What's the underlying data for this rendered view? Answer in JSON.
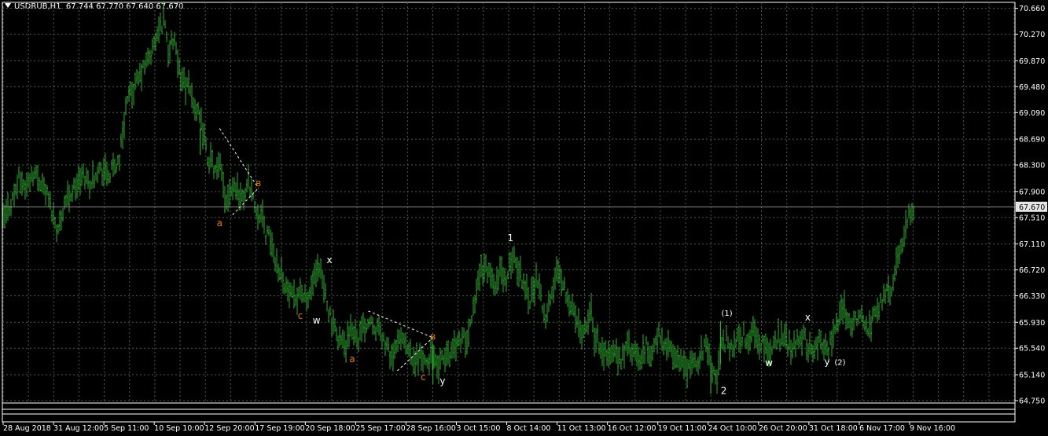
{
  "header": {
    "symbol_info": "USDRUB,H1",
    "ohlc": "67.744 67.770 67.640 67.670"
  },
  "colors": {
    "background": "#000000",
    "grid": "#4b5b4b",
    "bars": "#2faa2f",
    "price_line": "#8c8c8c",
    "price_label_bg": "#e6e6e6",
    "axis_text": "#ffffff",
    "wave_white": "#ffffff",
    "wave_orange": "#e07a10"
  },
  "chart_data": {
    "type": "ohlc-bar",
    "current_price": 67.67,
    "current_price_label": "67.670",
    "ylim": [
      64.75,
      70.75
    ],
    "y_ticks": [
      "70.660",
      "70.270",
      "69.870",
      "69.480",
      "69.090",
      "68.690",
      "68.300",
      "67.900",
      "67.510",
      "67.110",
      "66.720",
      "66.330",
      "65.930",
      "65.540",
      "65.140",
      "64.750"
    ],
    "x_ticks": [
      "28 Aug 2018",
      "31 Aug 12:00",
      "5 Sep 11:00",
      "10 Sep 10:00",
      "12 Sep 20:00",
      "17 Sep 19:00",
      "20 Sep 18:00",
      "25 Sep 17:00",
      "28 Sep 16:00",
      "3 Oct 15:00",
      "8 Oct 14:00",
      "11 Oct 13:00",
      "16 Oct 12:00",
      "19 Oct 11:00",
      "24 Oct 10:00",
      "26 Oct 20:00",
      "31 Oct 18:00",
      "6 Nov 17:00",
      "9 Nov 16:00"
    ],
    "price_path": [
      {
        "t": 0,
        "p": 67.45
      },
      {
        "t": 3,
        "p": 67.8
      },
      {
        "t": 5,
        "p": 68.1
      },
      {
        "t": 7,
        "p": 67.95
      },
      {
        "t": 9,
        "p": 68.2
      },
      {
        "t": 12,
        "p": 68.05
      },
      {
        "t": 14,
        "p": 67.8
      },
      {
        "t": 17,
        "p": 67.3
      },
      {
        "t": 19,
        "p": 67.75
      },
      {
        "t": 22,
        "p": 67.95
      },
      {
        "t": 25,
        "p": 68.15
      },
      {
        "t": 27,
        "p": 68.0
      },
      {
        "t": 29,
        "p": 68.25
      },
      {
        "t": 33,
        "p": 68.15
      },
      {
        "t": 36,
        "p": 68.4
      },
      {
        "t": 38,
        "p": 69.2
      },
      {
        "t": 41,
        "p": 69.5
      },
      {
        "t": 43,
        "p": 69.7
      },
      {
        "t": 46,
        "p": 70.0
      },
      {
        "t": 48,
        "p": 70.3
      },
      {
        "t": 50,
        "p": 70.55
      },
      {
        "t": 51,
        "p": 70.0
      },
      {
        "t": 53,
        "p": 70.2
      },
      {
        "t": 54,
        "p": 69.75
      },
      {
        "t": 56,
        "p": 69.55
      },
      {
        "t": 58,
        "p": 69.4
      },
      {
        "t": 60,
        "p": 69.1
      },
      {
        "t": 62,
        "p": 68.8
      },
      {
        "t": 63,
        "p": 68.45
      },
      {
        "t": 65,
        "p": 68.3
      },
      {
        "t": 66,
        "p": 68.15
      },
      {
        "t": 67,
        "p": 68.3
      },
      {
        "t": 69,
        "p": 67.75
      },
      {
        "t": 70,
        "p": 67.95
      },
      {
        "t": 72,
        "p": 68.0
      },
      {
        "t": 74,
        "p": 67.75
      },
      {
        "t": 76,
        "p": 68.05
      },
      {
        "t": 77,
        "p": 67.9
      },
      {
        "t": 78,
        "p": 67.65
      },
      {
        "t": 80,
        "p": 67.55
      },
      {
        "t": 81,
        "p": 67.3
      },
      {
        "t": 83,
        "p": 67.15
      },
      {
        "t": 84,
        "p": 66.9
      },
      {
        "t": 86,
        "p": 66.7
      },
      {
        "t": 88,
        "p": 66.4
      },
      {
        "t": 90,
        "p": 66.25
      },
      {
        "t": 92,
        "p": 66.45
      },
      {
        "t": 94,
        "p": 66.2
      },
      {
        "t": 96,
        "p": 66.55
      },
      {
        "t": 98,
        "p": 66.7
      },
      {
        "t": 99,
        "p": 66.5
      },
      {
        "t": 100,
        "p": 66.3
      },
      {
        "t": 102,
        "p": 65.85
      },
      {
        "t": 104,
        "p": 65.7
      },
      {
        "t": 106,
        "p": 65.55
      },
      {
        "t": 108,
        "p": 65.85
      },
      {
        "t": 110,
        "p": 65.7
      },
      {
        "t": 112,
        "p": 65.9
      },
      {
        "t": 114,
        "p": 66.0
      },
      {
        "t": 116,
        "p": 65.8
      },
      {
        "t": 118,
        "p": 65.65
      },
      {
        "t": 119,
        "p": 65.5
      },
      {
        "t": 121,
        "p": 65.4
      },
      {
        "t": 123,
        "p": 65.75
      },
      {
        "t": 125,
        "p": 65.5
      },
      {
        "t": 127,
        "p": 65.3
      },
      {
        "t": 129,
        "p": 65.45
      },
      {
        "t": 131,
        "p": 65.25
      },
      {
        "t": 133,
        "p": 65.55
      },
      {
        "t": 134,
        "p": 65.2
      },
      {
        "t": 136,
        "p": 65.35
      },
      {
        "t": 138,
        "p": 65.45
      },
      {
        "t": 140,
        "p": 65.6
      },
      {
        "t": 142,
        "p": 65.7
      },
      {
        "t": 144,
        "p": 65.65
      },
      {
        "t": 145,
        "p": 66.0
      },
      {
        "t": 146,
        "p": 66.3
      },
      {
        "t": 147,
        "p": 66.6
      },
      {
        "t": 149,
        "p": 66.8
      },
      {
        "t": 151,
        "p": 66.6
      },
      {
        "t": 153,
        "p": 66.5
      },
      {
        "t": 154,
        "p": 66.75
      },
      {
        "t": 156,
        "p": 66.5
      },
      {
        "t": 157,
        "p": 66.85
      },
      {
        "t": 158,
        "p": 66.95
      },
      {
        "t": 159,
        "p": 66.8
      },
      {
        "t": 161,
        "p": 66.55
      },
      {
        "t": 163,
        "p": 66.3
      },
      {
        "t": 165,
        "p": 66.55
      },
      {
        "t": 167,
        "p": 66.2
      },
      {
        "t": 168,
        "p": 66.0
      },
      {
        "t": 170,
        "p": 66.4
      },
      {
        "t": 172,
        "p": 66.8
      },
      {
        "t": 173,
        "p": 66.55
      },
      {
        "t": 175,
        "p": 66.3
      },
      {
        "t": 177,
        "p": 66.0
      },
      {
        "t": 179,
        "p": 65.8
      },
      {
        "t": 181,
        "p": 66.0
      },
      {
        "t": 182,
        "p": 66.2
      },
      {
        "t": 183,
        "p": 65.7
      },
      {
        "t": 185,
        "p": 65.6
      },
      {
        "t": 187,
        "p": 65.4
      },
      {
        "t": 189,
        "p": 65.5
      },
      {
        "t": 191,
        "p": 65.3
      },
      {
        "t": 193,
        "p": 65.6
      },
      {
        "t": 195,
        "p": 65.45
      },
      {
        "t": 197,
        "p": 65.35
      },
      {
        "t": 199,
        "p": 65.55
      },
      {
        "t": 201,
        "p": 65.45
      },
      {
        "t": 203,
        "p": 65.75
      },
      {
        "t": 205,
        "p": 65.6
      },
      {
        "t": 206,
        "p": 65.5
      },
      {
        "t": 208,
        "p": 65.45
      },
      {
        "t": 210,
        "p": 65.3
      },
      {
        "t": 212,
        "p": 65.2
      },
      {
        "t": 214,
        "p": 65.3
      },
      {
        "t": 216,
        "p": 65.45
      },
      {
        "t": 218,
        "p": 65.6
      },
      {
        "t": 219,
        "p": 65.3
      },
      {
        "t": 221,
        "p": 65.1
      },
      {
        "t": 222,
        "p": 65.5
      },
      {
        "t": 224,
        "p": 65.7
      },
      {
        "t": 225,
        "p": 65.5
      },
      {
        "t": 227,
        "p": 65.65
      },
      {
        "t": 229,
        "p": 65.75
      },
      {
        "t": 231,
        "p": 65.6
      },
      {
        "t": 232,
        "p": 65.85
      },
      {
        "t": 234,
        "p": 65.65
      },
      {
        "t": 236,
        "p": 65.5
      },
      {
        "t": 238,
        "p": 65.55
      },
      {
        "t": 240,
        "p": 65.7
      },
      {
        "t": 242,
        "p": 65.65
      },
      {
        "t": 244,
        "p": 65.55
      },
      {
        "t": 246,
        "p": 65.7
      },
      {
        "t": 248,
        "p": 65.75
      },
      {
        "t": 249,
        "p": 65.55
      },
      {
        "t": 251,
        "p": 65.55
      },
      {
        "t": 253,
        "p": 65.65
      },
      {
        "t": 255,
        "p": 65.5
      },
      {
        "t": 257,
        "p": 65.7
      },
      {
        "t": 259,
        "p": 66.0
      },
      {
        "t": 260,
        "p": 66.15
      },
      {
        "t": 262,
        "p": 65.9
      },
      {
        "t": 264,
        "p": 65.95
      },
      {
        "t": 266,
        "p": 66.05
      },
      {
        "t": 267,
        "p": 65.85
      },
      {
        "t": 269,
        "p": 65.95
      },
      {
        "t": 271,
        "p": 66.2
      },
      {
        "t": 273,
        "p": 66.35
      },
      {
        "t": 275,
        "p": 66.45
      },
      {
        "t": 277,
        "p": 66.9
      },
      {
        "t": 279,
        "p": 67.3
      },
      {
        "t": 281,
        "p": 67.6
      },
      {
        "t": 282,
        "p": 67.7
      }
    ],
    "special_wicks": [
      {
        "t": 61,
        "low": 68.45,
        "high": 68.85
      },
      {
        "t": 133,
        "low": 65.0,
        "high": 65.6
      },
      {
        "t": 219,
        "low": 64.85,
        "high": 65.4
      },
      {
        "t": 222,
        "low": 65.3,
        "high": 65.95
      }
    ],
    "wave_labels": [
      {
        "text": "a",
        "t": 67,
        "p": 67.38,
        "color": "orange"
      },
      {
        "text": "в",
        "t": 79,
        "p": 67.98,
        "color": "orange"
      },
      {
        "text": "c",
        "t": 92,
        "p": 65.98,
        "color": "orange"
      },
      {
        "text": "w",
        "t": 97,
        "p": 65.91,
        "color": "white"
      },
      {
        "text": "x",
        "t": 101,
        "p": 66.82,
        "color": "white"
      },
      {
        "text": "a",
        "t": 108,
        "p": 65.33,
        "color": "orange"
      },
      {
        "text": "в",
        "t": 133,
        "p": 65.67,
        "color": "orange"
      },
      {
        "text": "c",
        "t": 130,
        "p": 65.06,
        "color": "orange"
      },
      {
        "text": "y",
        "t": 136,
        "p": 65.0,
        "color": "white"
      },
      {
        "text": "1",
        "t": 157,
        "p": 67.15,
        "color": "white"
      },
      {
        "text": "(1)",
        "t": 224,
        "p": 66.03,
        "color": "white"
      },
      {
        "text": "2",
        "t": 223,
        "p": 64.85,
        "color": "white"
      },
      {
        "text": "w",
        "t": 237,
        "p": 65.27,
        "color": "white"
      },
      {
        "text": "x",
        "t": 249,
        "p": 65.96,
        "color": "white"
      },
      {
        "text": "y",
        "t": 255,
        "p": 65.29,
        "color": "white"
      },
      {
        "text": "(2)",
        "t": 259,
        "p": 65.29,
        "color": "white"
      }
    ],
    "wave_lines": [
      {
        "from": {
          "t": 67,
          "p": 68.85
        },
        "to": {
          "t": 79,
          "p": 67.95
        }
      },
      {
        "from": {
          "t": 71,
          "p": 67.55
        },
        "to": {
          "t": 79,
          "p": 67.95
        }
      },
      {
        "from": {
          "t": 113,
          "p": 66.1
        },
        "to": {
          "t": 133,
          "p": 65.7
        }
      },
      {
        "from": {
          "t": 122,
          "p": 65.2
        },
        "to": {
          "t": 133,
          "p": 65.7
        }
      }
    ]
  }
}
